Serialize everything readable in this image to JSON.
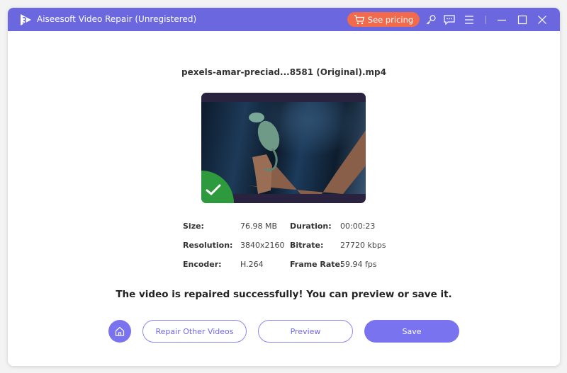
{
  "titlebar": {
    "title": "Aiseesoft Video Repair (Unregistered)",
    "pricing_label": "See pricing",
    "icons": [
      "app-logo-icon",
      "cart-icon",
      "key-icon",
      "feedback-icon",
      "menu-icon",
      "minimize-icon",
      "maximize-icon",
      "close-icon"
    ]
  },
  "file": {
    "name": "pexels-amar-preciad...8581 (Original).mp4",
    "status_icon": "check-icon"
  },
  "info": {
    "left": [
      {
        "label": "Size:",
        "value": "76.98 MB"
      },
      {
        "label": "Resolution:",
        "value": "3840x2160"
      },
      {
        "label": "Encoder:",
        "value": "H.264"
      }
    ],
    "right": [
      {
        "label": "Duration:",
        "value": "00:00:23"
      },
      {
        "label": "Bitrate:",
        "value": "27720 kbps"
      },
      {
        "label": "Frame Rate:",
        "value": "59.94 fps"
      }
    ]
  },
  "message": "The video is repaired successfully! You can preview or save it.",
  "actions": {
    "home_icon": "home-icon",
    "repair_other": "Repair Other Videos",
    "preview": "Preview",
    "save": "Save"
  },
  "colors": {
    "accent": "#6a67df",
    "button": "#7a73f0",
    "pricing": "#f26a4c",
    "success": "#2e9a3e"
  }
}
